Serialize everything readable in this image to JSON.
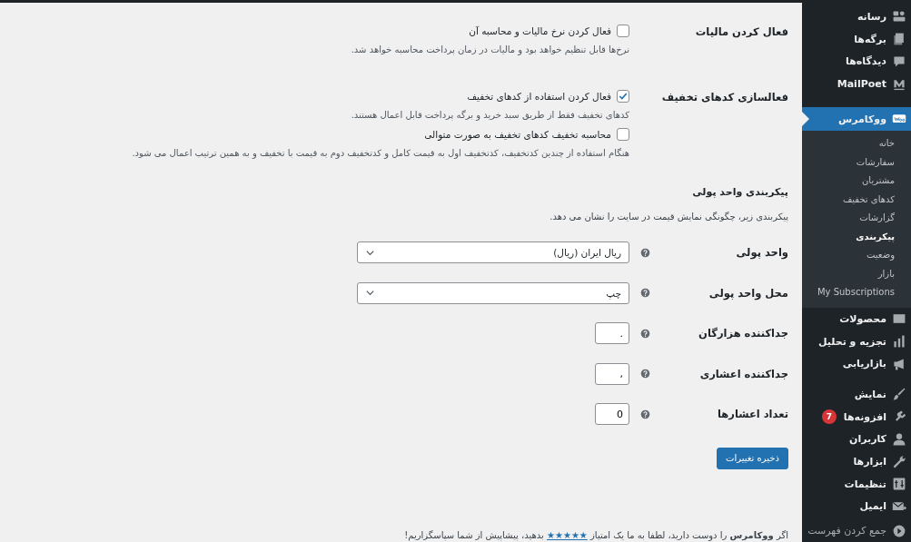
{
  "sidebar": {
    "items": [
      {
        "label": "رسانه",
        "selected": false
      },
      {
        "label": "برگه‌ها",
        "selected": false
      },
      {
        "label": "دیدگاه‌ها",
        "selected": false
      },
      {
        "label": "MailPoet",
        "selected": false
      },
      {
        "label": "ووکامرس",
        "selected": true,
        "children": [
          {
            "label": "خانه",
            "selected": false
          },
          {
            "label": "سفارشات",
            "selected": false
          },
          {
            "label": "مشتریان",
            "selected": false
          },
          {
            "label": "کدهای تخفیف",
            "selected": false
          },
          {
            "label": "گزارشات",
            "selected": false
          },
          {
            "label": "پیکربندی",
            "selected": true
          },
          {
            "label": "وضعیت",
            "selected": false
          },
          {
            "label": "بازار",
            "selected": false
          },
          {
            "label": "My Subscriptions",
            "selected": false
          }
        ]
      },
      {
        "label": "محصولات",
        "selected": false
      },
      {
        "label": "تجزیه و تحلیل",
        "selected": false
      },
      {
        "label": "بازاریابی",
        "selected": false
      },
      {
        "label": "نمایش",
        "selected": false
      },
      {
        "label": "افزونه‌ها",
        "selected": false,
        "badge": "7"
      },
      {
        "label": "کاربران",
        "selected": false
      },
      {
        "label": "ابزارها",
        "selected": false
      },
      {
        "label": "تنظیمات",
        "selected": false
      },
      {
        "label": "ایمیل",
        "selected": false
      }
    ],
    "collapse": "جمع کردن فهرست"
  },
  "settings": [
    {
      "label": "فعال کردن مالیات",
      "options": [
        {
          "label": "فعال کردن نرخ مالیات و محاسبه آن",
          "checked": false,
          "description": "نرخ‌ها قابل تنظیم خواهد بود و مالیات در زمان پرداخت محاسبه خواهد شد."
        }
      ]
    },
    {
      "label": "فعالسازی کدهای تخفیف",
      "options": [
        {
          "label": "فعال کردن استفاده از کدهای تخفیف",
          "checked": true,
          "description": "کدهای تخفیف فقط از طریق سبد خرید و برگه پرداخت قابل اعمال هستند."
        },
        {
          "label": "محاسبه تخفیف کدهای تخفیف به صورت متوالی",
          "checked": false,
          "description": "هنگام استفاده از چندین کدتخفیف، کدتخفیف اول به قیمت کامل و کدتخفیف دوم به قیمت با تخفیف و به همین ترتیب اعمال می شود."
        }
      ]
    }
  ],
  "currency": {
    "heading": "پیکربندی واحد پولی",
    "description": "پیکربندی زیر، چگونگی نمایش قیمت در سایت را نشان می دهد.",
    "fields": [
      {
        "kind": "select",
        "label": "واحد پولی",
        "value": "ریال ایران (ریال)"
      },
      {
        "kind": "select",
        "label": "محل واحد پولی",
        "value": "چپ"
      },
      {
        "kind": "text",
        "label": "جداکننده هزارگان",
        "value": "."
      },
      {
        "kind": "text",
        "label": "جداکننده اعشاری",
        "value": ","
      },
      {
        "kind": "text",
        "label": "تعداد اعشارها",
        "value": "0"
      }
    ]
  },
  "save_button": "ذخیره تغییرات",
  "footer": {
    "before": "اگر **ووکامرس** را دوست دارید، لطفا به ما یک امتیاز",
    "link": "★★★★★",
    "after": "بدهید، پیشاپیش از شما سپاسگزاریم!"
  }
}
